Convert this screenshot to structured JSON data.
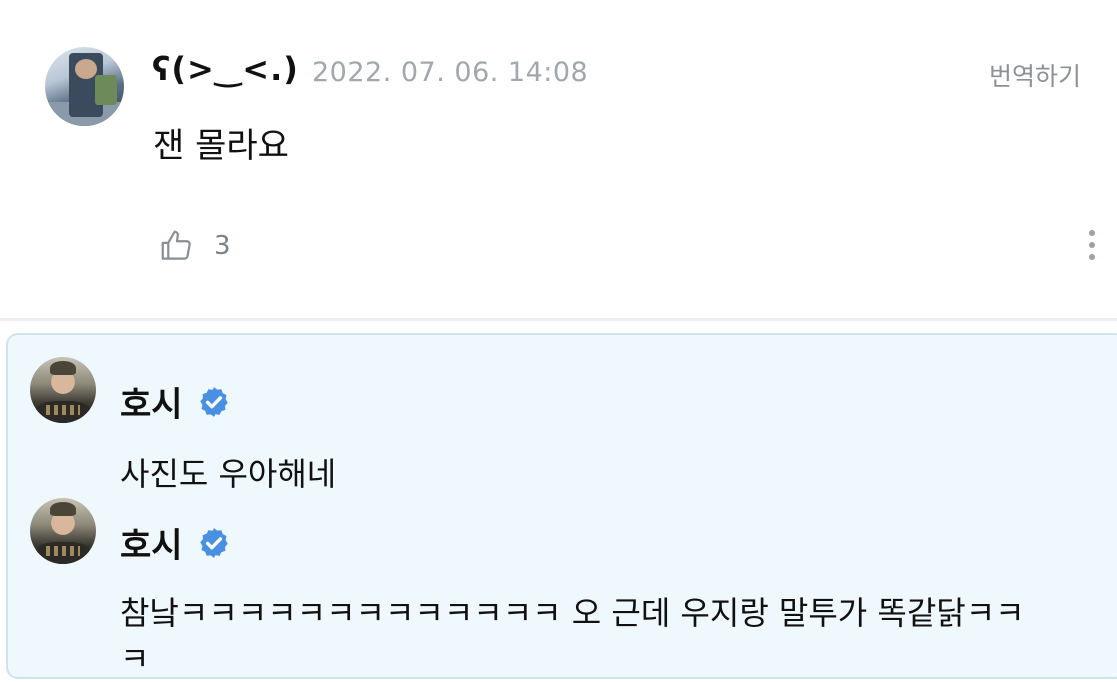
{
  "comment": {
    "author": "ʕ(>‿<.)",
    "timestamp": "2022. 07. 06. 14:08",
    "translate_label": "번역하기",
    "text": "잰 몰라요",
    "like_count": "3"
  },
  "replies": [
    {
      "author": "호시",
      "verified": true,
      "text": "사진도 우아해네"
    },
    {
      "author": "호시",
      "verified": true,
      "text_line1": "참낰ㅋㅋㅋㅋㅋㅋㅋㅋㅋㅋㅋㅋㅋ 오 근데 우지랑 말투가 똑같닭ㅋㅋ",
      "text_line2": "ㅋ"
    }
  ],
  "colors": {
    "reply_background": "#eef8fd",
    "reply_border": "#cfe3ef",
    "verified_badge": "#4a90e2",
    "timestamp": "#a3a7ad"
  }
}
